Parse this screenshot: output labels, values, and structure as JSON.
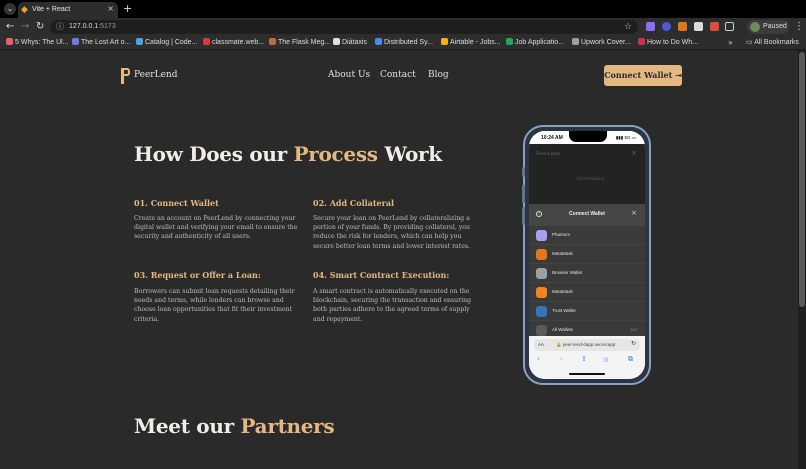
{
  "browser": {
    "tab_title": "Vite + React",
    "tab_close": "×",
    "new_tab": "+",
    "tab_menu": "⌄",
    "url_host": "127.0.0.1",
    "url_port": ":5173",
    "profile_label": "Paused",
    "bookmarks": [
      {
        "label": "5 Whys: The Ul...",
        "color": "#e85d75"
      },
      {
        "label": "The Lost Art o...",
        "color": "#6b7de0"
      },
      {
        "label": "Catalog | Code...",
        "color": "#4aa3df"
      },
      {
        "label": "classmate.web...",
        "color": "#d33c3c"
      },
      {
        "label": "The Flask Meg...",
        "color": "#b86a4a"
      },
      {
        "label": "Diátaxis",
        "color": "#e0e0e0"
      },
      {
        "label": "Distributed Sy...",
        "color": "#4a90e2"
      },
      {
        "label": "Airtable - Jobs...",
        "color": "#f2b01e"
      },
      {
        "label": "Job Applicatio...",
        "color": "#2aa35e"
      },
      {
        "label": "Upwork Cover...",
        "color": "#9e9e9e"
      },
      {
        "label": "How to Do Wh...",
        "color": "#c8344a"
      }
    ],
    "bookmarks_more": "»",
    "all_bookmarks": "All Bookmarks"
  },
  "site": {
    "logo": "PeerLend",
    "nav": [
      "About Us",
      "Contact",
      "Blog"
    ],
    "connect_button": "Connect Wallet ⇥",
    "process_heading_pre": "How Does our ",
    "process_heading_accent": "Process",
    "process_heading_post": " Work",
    "steps": [
      {
        "title": "01. Connect Wallet",
        "body": "Create an account on PeerLend by connecting your digital wallet and verifying your email to ensure the security and authenticity of all users."
      },
      {
        "title": "02. Add Collateral",
        "body": "Secure your loan on PeerLend by collateralizing a portion of your funds. By providing collateral, you reduce the risk for lenders, which can help you secure better loan terms and lower interest rates."
      },
      {
        "title": "03. Request or Offer a Loan:",
        "body": "Borrowers can submit loan requests detailing their needs and terms, while lenders can browse and choose loan opportunities that fit their investment criteria."
      },
      {
        "title": "04. Smart Contract Execution:",
        "body": "A smart contract is automatically executed on the blockchain, securing the transaction and ensuring both parties adhere to the agreed terms of supply and repayment."
      }
    ],
    "partners_heading_pre": "Meet our ",
    "partners_heading_accent": "Partners"
  },
  "phone": {
    "time": "10:24 AM",
    "status_icons": "▮▮▮ 5G ▭",
    "app_logo": "PeerLend",
    "app_close": "×",
    "app_section": "Governance",
    "modal_title": "Connect Wallet",
    "modal_close": "×",
    "modal_info": "?",
    "wallets": [
      {
        "label": "Phantom",
        "color": "#ab9ff2",
        "badge": ""
      },
      {
        "label": "MetaMask",
        "color": "#e2761b",
        "badge": ""
      },
      {
        "label": "Browser Wallet",
        "color": "#9aa0a6",
        "badge": ""
      },
      {
        "label": "MetaMask",
        "color": "#f5841f",
        "badge": ""
      },
      {
        "label": "Trust Wallet",
        "color": "#3375bb",
        "badge": ""
      },
      {
        "label": "All Wallets",
        "color": "#5a5a5a",
        "badge": "100"
      }
    ],
    "url_aa": "AA",
    "url_text": "🔒 peer-lend-dapp.vercel.app",
    "url_reload": "↻",
    "bottom_buttons": [
      "‹",
      "›",
      "⇪",
      "▯▯",
      "⧉"
    ]
  }
}
